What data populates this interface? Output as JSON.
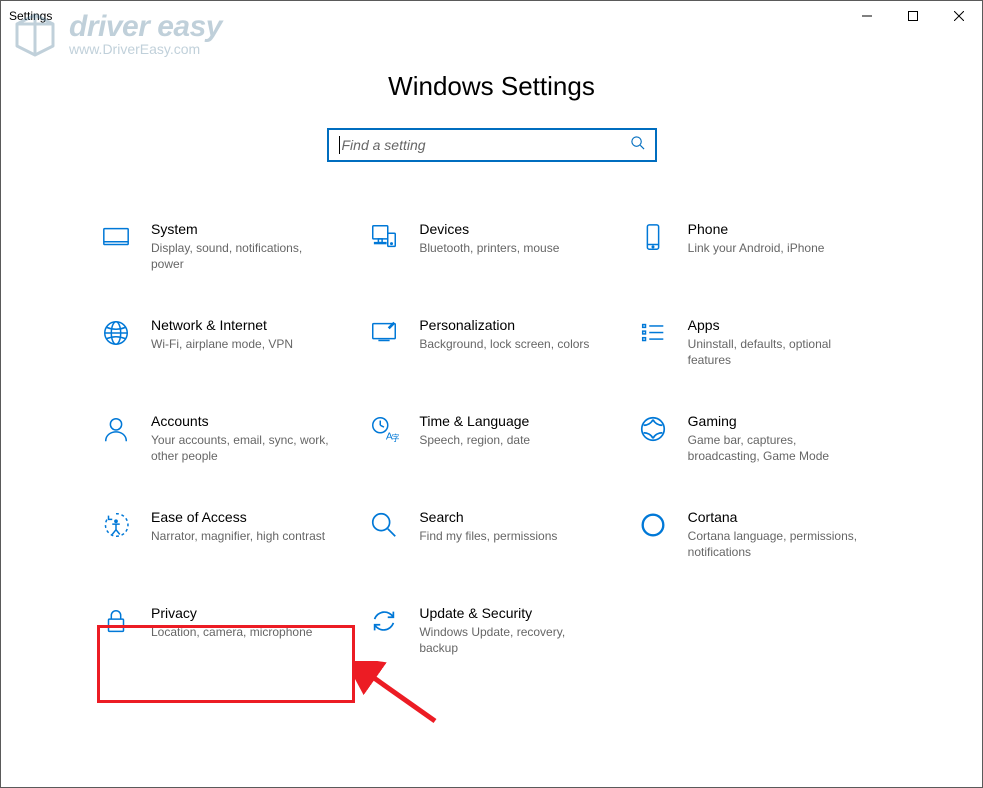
{
  "window": {
    "title": "Settings"
  },
  "watermark": {
    "line1": "driver easy",
    "line2": "www.DriverEasy.com"
  },
  "header": {
    "page_title": "Windows Settings"
  },
  "search": {
    "placeholder": "Find a setting"
  },
  "tiles": {
    "system": {
      "title": "System",
      "desc": "Display, sound, notifications, power"
    },
    "devices": {
      "title": "Devices",
      "desc": "Bluetooth, printers, mouse"
    },
    "phone": {
      "title": "Phone",
      "desc": "Link your Android, iPhone"
    },
    "network": {
      "title": "Network & Internet",
      "desc": "Wi-Fi, airplane mode, VPN"
    },
    "personalization": {
      "title": "Personalization",
      "desc": "Background, lock screen, colors"
    },
    "apps": {
      "title": "Apps",
      "desc": "Uninstall, defaults, optional features"
    },
    "accounts": {
      "title": "Accounts",
      "desc": "Your accounts, email, sync, work, other people"
    },
    "time": {
      "title": "Time & Language",
      "desc": "Speech, region, date"
    },
    "gaming": {
      "title": "Gaming",
      "desc": "Game bar, captures, broadcasting, Game Mode"
    },
    "ease": {
      "title": "Ease of Access",
      "desc": "Narrator, magnifier, high contrast"
    },
    "searchtile": {
      "title": "Search",
      "desc": "Find my files, permissions"
    },
    "cortana": {
      "title": "Cortana",
      "desc": "Cortana language, permissions, notifications"
    },
    "privacy": {
      "title": "Privacy",
      "desc": "Location, camera, microphone"
    },
    "update": {
      "title": "Update & Security",
      "desc": "Windows Update, recovery, backup"
    }
  },
  "colors": {
    "accent": "#0078d7",
    "search_border": "#006dbf",
    "annotation": "#ec1c24"
  },
  "annotation": {
    "highlighted_tile": "privacy"
  }
}
